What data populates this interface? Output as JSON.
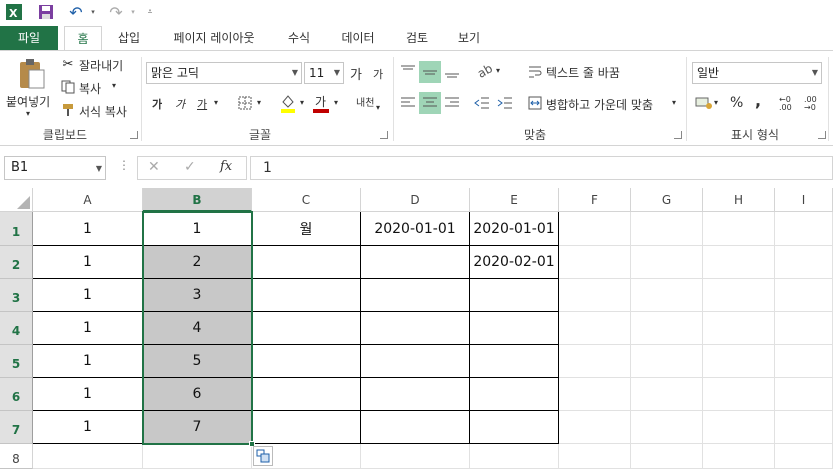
{
  "qat": {
    "undo": "↶",
    "redo": "↷"
  },
  "tabs": [
    "파일",
    "홈",
    "삽입",
    "페이지 레이아웃",
    "수식",
    "데이터",
    "검토",
    "보기"
  ],
  "ribbon": {
    "paste_label": "붙여넣기",
    "cut_label": "잘라내기",
    "copy_label": "복사",
    "format_painter_label": "서식 복사",
    "clipboard_group": "클립보드",
    "font_name": "맑은 고딕",
    "font_size": "11",
    "font_group": "글꼴",
    "grow_font": "가",
    "shrink_font": "가",
    "bold": "가",
    "italic": "가",
    "underline": "가",
    "font_color_glyph": "가",
    "phonetic": "내천",
    "wrap_text_label": "텍스트 줄 바꿈",
    "merge_center_label": "병합하고 가운데 맞춤",
    "alignment_group": "맞춤",
    "number_format": "일반",
    "percent": "%",
    "comma": ",",
    "number_group": "표시 형식",
    "fill_color": "#ffff00",
    "font_color": "#c00000"
  },
  "formula_bar": {
    "name_box": "B1",
    "fx": "fx",
    "value": "1"
  },
  "columns": [
    "A",
    "B",
    "C",
    "D",
    "E",
    "F",
    "G",
    "H",
    "I"
  ],
  "rows": [
    "1",
    "2",
    "3",
    "4",
    "5",
    "6",
    "7",
    "8"
  ],
  "cells": {
    "A": [
      "1",
      "1",
      "1",
      "1",
      "1",
      "1",
      "1"
    ],
    "B": [
      "1",
      "2",
      "3",
      "4",
      "5",
      "6",
      "7"
    ],
    "C": [
      "월",
      "",
      "",
      "",
      "",
      "",
      ""
    ],
    "D": [
      "2020-01-01",
      "",
      "",
      "",
      "",
      "",
      ""
    ],
    "E": [
      "2020-01-01",
      "2020-02-01",
      "",
      "",
      "",
      "",
      ""
    ]
  },
  "colors": {
    "accent": "#217346",
    "selection_fill": "#c8c8c8"
  }
}
